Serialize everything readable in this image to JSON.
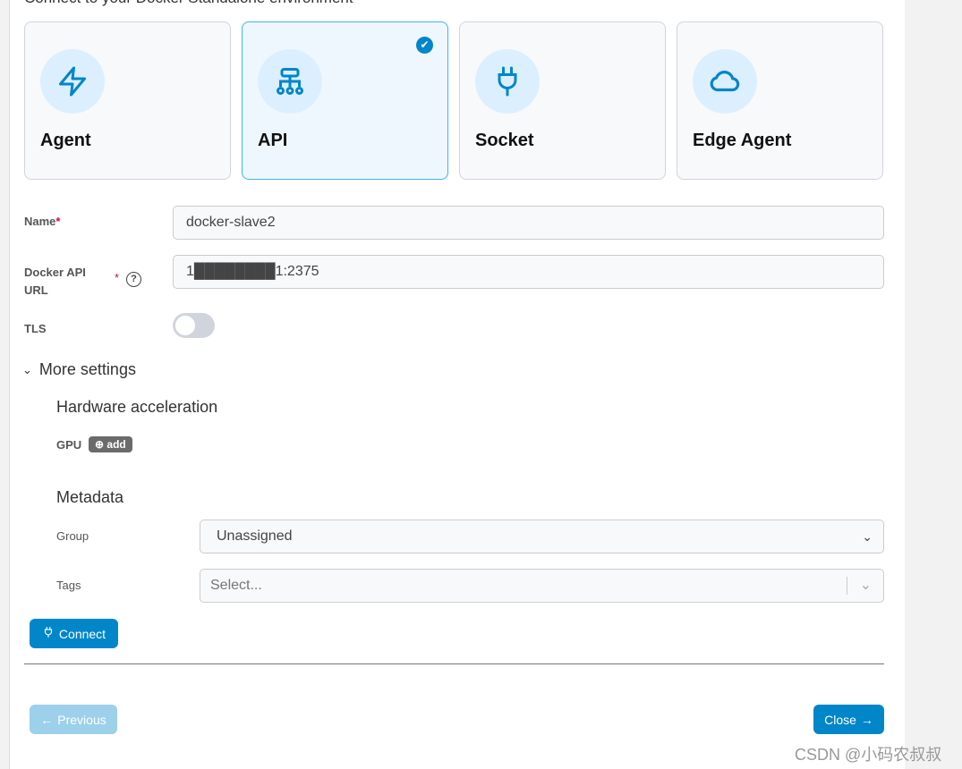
{
  "subtitle": "Connect to your Docker Standalone environment",
  "options": [
    {
      "label": "Agent",
      "icon": "lightning-icon"
    },
    {
      "label": "API",
      "icon": "network-icon",
      "selected": true
    },
    {
      "label": "Socket",
      "icon": "plug-icon"
    },
    {
      "label": "Edge Agent",
      "icon": "cloud-icon"
    }
  ],
  "form": {
    "name_label": "Name",
    "name_value": "docker-slave2",
    "required": "*",
    "url_label_1": "Docker API",
    "url_label_2": "URL",
    "url_value": "1████████1:2375",
    "tls_label": "TLS",
    "tls_on": false
  },
  "more_settings": "More settings",
  "hardware": {
    "title": "Hardware acceleration",
    "gpu_label": "GPU",
    "add_label": "add"
  },
  "metadata": {
    "title": "Metadata",
    "group_label": "Group",
    "group_value": "Unassigned",
    "tags_label": "Tags",
    "tags_placeholder": "Select..."
  },
  "buttons": {
    "connect": "Connect",
    "previous": "Previous",
    "close": "Close"
  },
  "watermark": "CSDN @小码农叔叔",
  "colors": {
    "primary": "#0086c9",
    "selected_border": "#3ab6f0",
    "required": "#c0134d"
  }
}
